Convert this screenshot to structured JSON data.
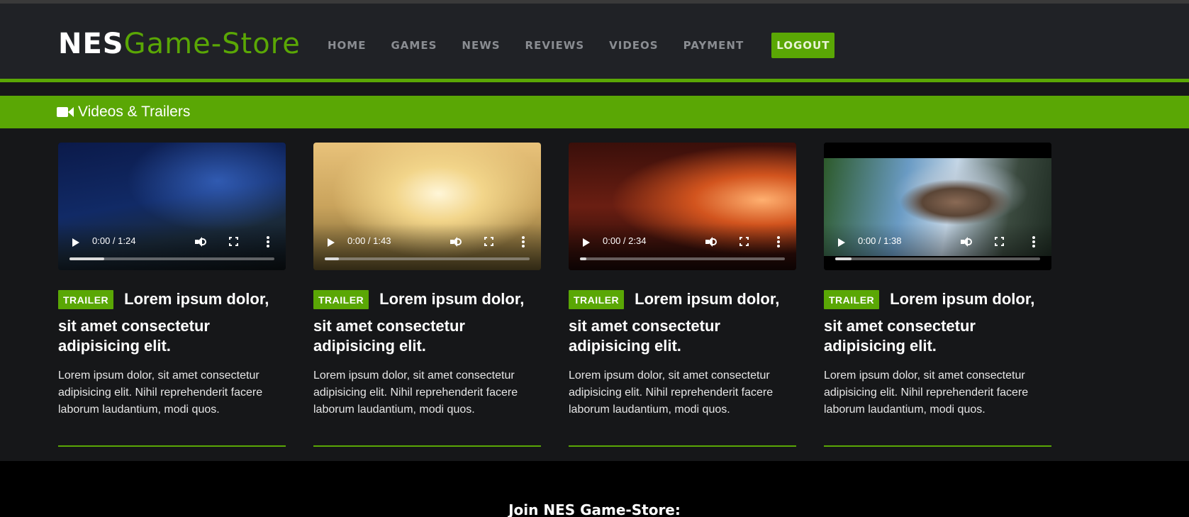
{
  "header": {
    "logo_part1": "NES",
    "logo_part2": "Game-Store",
    "nav": [
      "HOME",
      "GAMES",
      "NEWS",
      "REVIEWS",
      "VIDEOS",
      "PAYMENT"
    ],
    "logout_label": "LOGOUT",
    "accent_color": "#5aa705"
  },
  "section": {
    "icon": "video-camera-icon",
    "title": "Videos & Trailers"
  },
  "videos": [
    {
      "time": "0:00 / 1:24",
      "progress": 0.17,
      "badge": "TRAILER",
      "title_first": "Lorem ipsum dolor,",
      "title_rest": "sit amet consectetur adipisicing elit.",
      "description": "Lorem ipsum dolor, sit amet consectetur adipisicing elit. Nihil reprehenderit facere laborum laudantium, modi quos."
    },
    {
      "time": "0:00 / 1:43",
      "progress": 0.07,
      "badge": "TRAILER",
      "title_first": "Lorem ipsum dolor,",
      "title_rest": "sit amet consectetur adipisicing elit.",
      "description": "Lorem ipsum dolor, sit amet consectetur adipisicing elit. Nihil reprehenderit facere laborum laudantium, modi quos."
    },
    {
      "time": "0:00 / 2:34",
      "progress": 0.03,
      "badge": "TRAILER",
      "title_first": "Lorem ipsum dolor,",
      "title_rest": "sit amet consectetur adipisicing elit.",
      "description": "Lorem ipsum dolor, sit amet consectetur adipisicing elit. Nihil reprehenderit facere laborum laudantium, modi quos."
    },
    {
      "time": "0:00 / 1:38",
      "progress": 0.08,
      "badge": "TRAILER",
      "title_first": "Lorem ipsum dolor,",
      "title_rest": "sit amet consectetur adipisicing elit.",
      "description": "Lorem ipsum dolor, sit amet consectetur adipisicing elit. Nihil reprehenderit facere laborum laudantium, modi quos."
    }
  ],
  "footer": {
    "title": "Join NES Game-Store:"
  }
}
